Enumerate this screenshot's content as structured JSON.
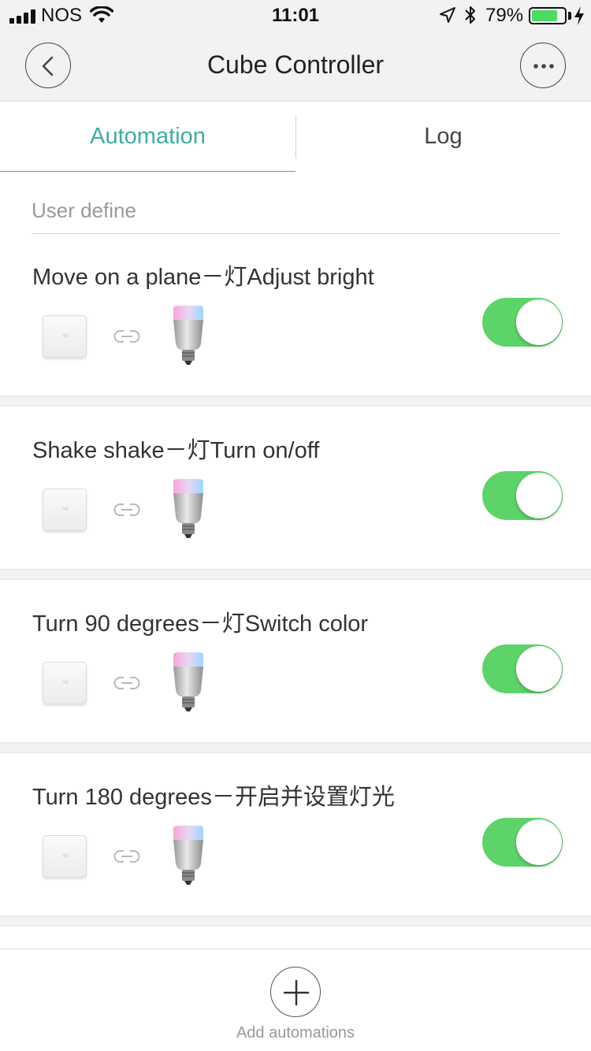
{
  "status_bar": {
    "carrier": "NOS",
    "time": "11:01",
    "battery_percent": "79%",
    "battery_level": 0.79,
    "icons": [
      "signal-icon",
      "wifi-icon",
      "location-arrow-icon",
      "bluetooth-icon",
      "battery-icon",
      "charging-bolt-icon"
    ]
  },
  "nav": {
    "title": "Cube Controller",
    "back_icon": "chevron-left-icon",
    "more_icon": "more-dots-icon"
  },
  "tabs": [
    {
      "label": "Automation",
      "active": true
    },
    {
      "label": "Log",
      "active": false
    }
  ],
  "section": {
    "label": "User define"
  },
  "automations": [
    {
      "title": "Move on a plane－灯Adjust bright",
      "enabled": true
    },
    {
      "title": "Shake shake－灯Turn on/off",
      "enabled": true
    },
    {
      "title": "Turn 90 degrees－灯Switch color",
      "enabled": true
    },
    {
      "title": "Turn 180 degrees－开启并设置灯光",
      "enabled": true
    }
  ],
  "devices": {
    "trigger": "cube-device-icon",
    "link": "link-icon",
    "target": "bulb-device-icon"
  },
  "footer": {
    "add_label": "Add automations",
    "add_icon": "plus-icon"
  },
  "colors": {
    "accent": "#3fada4",
    "toggle_on": "#5ed36a",
    "background_gray": "#f2f2f2"
  }
}
